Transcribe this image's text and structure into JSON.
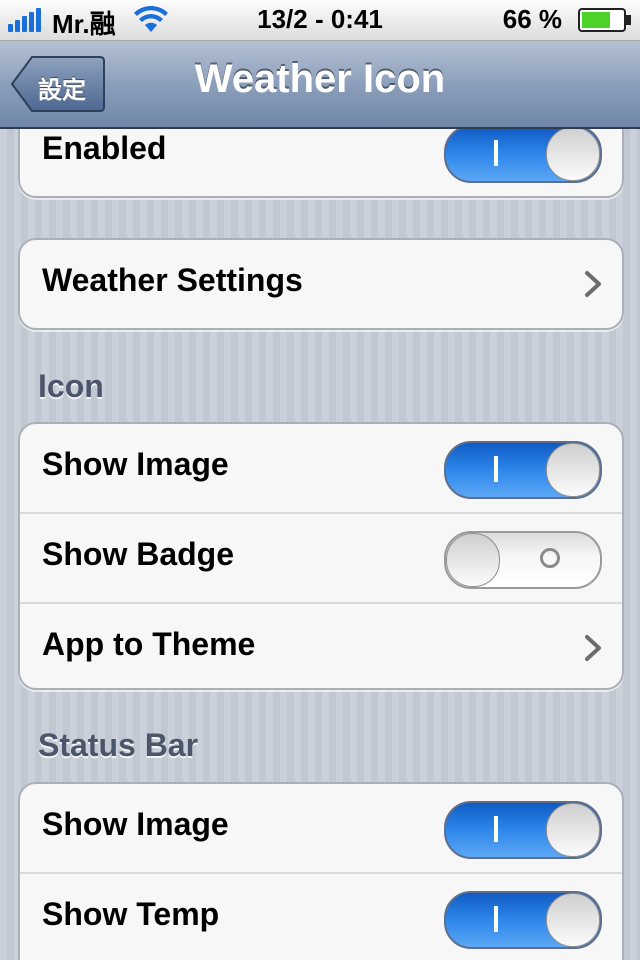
{
  "status_bar": {
    "carrier": "Mr.融",
    "time": "13/2 - 0:41",
    "battery_percent": "66 %"
  },
  "nav": {
    "back_label": "設定",
    "title": "Weather Icon"
  },
  "groups": {
    "enabled": {
      "label": "Enabled",
      "on": true
    },
    "weather_settings": {
      "label": "Weather Settings"
    },
    "icon": {
      "header": "Icon",
      "show_image": {
        "label": "Show Image",
        "on": true
      },
      "show_badge": {
        "label": "Show Badge",
        "on": false
      },
      "app_to_theme": {
        "label": "App to Theme"
      }
    },
    "status_bar": {
      "header": "Status Bar",
      "show_image": {
        "label": "Show Image",
        "on": true
      },
      "show_temp": {
        "label": "Show Temp",
        "on": true
      }
    }
  },
  "colors": {
    "toggle_on": "#2e87ea",
    "nav_bar": "#8c9fbb",
    "signal": "#1b6fd8",
    "battery": "#4cd32a"
  },
  "icons": [
    "signal-bars-icon",
    "wifi-icon",
    "battery-icon",
    "back-arrow-icon",
    "chevron-right-icon"
  ]
}
